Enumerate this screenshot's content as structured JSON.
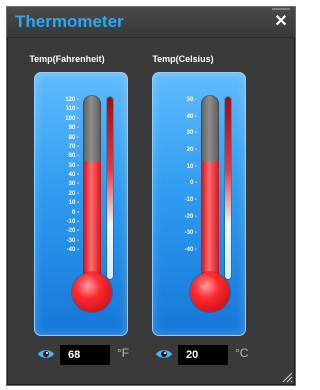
{
  "window": {
    "title": "Thermometer"
  },
  "columns": [
    {
      "label": "Temp(Fahrenheit)",
      "value": "68",
      "unit": "°F",
      "fill_percent": 67,
      "ticks": [
        "120",
        "110",
        "100",
        "90",
        "80",
        "70",
        "60",
        "50",
        "40",
        "30",
        "20",
        "10",
        "0",
        "-10",
        "-20",
        "-30",
        "-40"
      ]
    },
    {
      "label": "Temp(Celsius)",
      "value": "20",
      "unit": "°C",
      "fill_percent": 67,
      "ticks": [
        "50",
        "40",
        "30",
        "20",
        "10",
        "0",
        "-10",
        "-20",
        "-30",
        "-40"
      ]
    }
  ],
  "colors": {
    "title": "#2ea7f0",
    "panel_start": "#61bbff",
    "panel_end": "#1577d8",
    "mercury": "#ff2a31"
  }
}
